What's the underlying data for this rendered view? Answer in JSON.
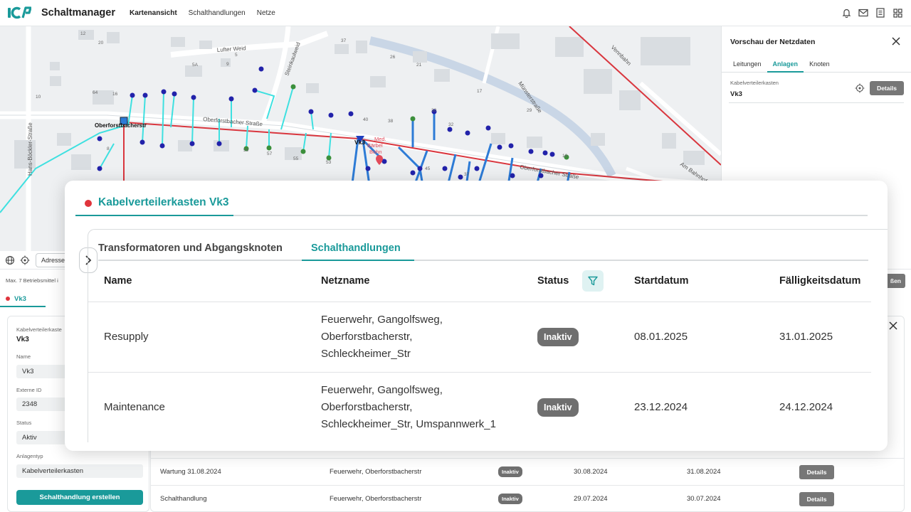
{
  "app": {
    "title": "Schaltmanager",
    "logo_text": "ICP",
    "nav": [
      "Kartenansicht",
      "Schalthandlungen",
      "Netze"
    ],
    "active_nav": "Kartenansicht",
    "top_icons": [
      "bell-icon",
      "mail-icon",
      "list-icon",
      "grid-icon"
    ]
  },
  "map": {
    "streets": [
      "Lufter Weid",
      "Steinkaulweid",
      "Oberforstbacher Straße",
      "Münsterstraße",
      "Vennbahn",
      "Hans-Böckler-Straße",
      "Am Bahnhof"
    ],
    "selected_label": "Oberforstbacherstr",
    "node_label": "Vk3",
    "poi": [
      "Med.",
      "Bärbel",
      "Bohn"
    ],
    "house_numbers": [
      "12",
      "20",
      "16",
      "37",
      "26",
      "9",
      "5A",
      "5",
      "21",
      "17",
      "64",
      "10",
      "16",
      "8",
      "59",
      "57",
      "55",
      "53",
      "45",
      "37",
      "16",
      "31",
      "29",
      "32",
      "30"
    ],
    "colors": {
      "network": "#2d7bd6",
      "feeder": "#3ee0e0",
      "mainline": "#d9363e"
    }
  },
  "preview": {
    "title": "Vorschau der Netzdaten",
    "tabs": [
      "Leitungen",
      "Anlagen",
      "Knoten"
    ],
    "active_tab": "Anlagen",
    "type_label": "Kabelverteilerkasten",
    "value": "Vk3",
    "details_btn": "Details"
  },
  "toolbar": {
    "address_placeholder": "Adresse",
    "info": "Max. 7 Betriebsmittel i",
    "close_btn": "ßen"
  },
  "left_tab": {
    "label": "Vk3"
  },
  "form": {
    "type_label": "Kabelverteilerkaste",
    "type_value": "Vk3",
    "name_label": "Name",
    "name_value": "Vk3",
    "extid_label": "Externe ID",
    "extid_value": "2348",
    "status_label": "Status",
    "status_value": "Aktiv",
    "anlagentyp_label": "Anlagentyp",
    "anlagentyp_value": "Kabelverteilerkasten",
    "create_btn": "Schalthandlung erstellen"
  },
  "bg_table": {
    "rows": [
      {
        "name": "Wartung 31.08.2024",
        "netz": "Feuerwehr, Oberforstbacherstr",
        "status": "Inaktiv",
        "start": "30.08.2024",
        "faellig": "31.08.2024",
        "action": "Details"
      },
      {
        "name": "Schalthandlung",
        "netz": "Feuerwehr, Oberforstbacherstr",
        "status": "Inaktiv",
        "start": "29.07.2024",
        "faellig": "30.07.2024",
        "action": "Details"
      }
    ]
  },
  "modal": {
    "title": "Kabelverteilerkasten Vk3",
    "tabs": [
      "Transformatoren und Abgangsknoten",
      "Schalthandlungen"
    ],
    "active_tab": "Schalthandlungen",
    "columns": [
      "Name",
      "Netzname",
      "Status",
      "Startdatum",
      "Fälligkeitsdatum"
    ],
    "rows": [
      {
        "name": "Resupply",
        "netz": [
          "Feuerwehr, Gangolfsweg,",
          "Oberforstbacherstr,",
          "Schleckheimer_Str"
        ],
        "status": "Inaktiv",
        "start": "08.01.2025",
        "faellig": "31.01.2025"
      },
      {
        "name": "Maintenance",
        "netz": [
          "Feuerwehr, Gangolfsweg,",
          "Oberforstbacherstr,",
          "Schleckheimer_Str, Umspannwerk_1"
        ],
        "status": "Inaktiv",
        "start": "23.12.2024",
        "faellig": "24.12.2024"
      }
    ]
  }
}
